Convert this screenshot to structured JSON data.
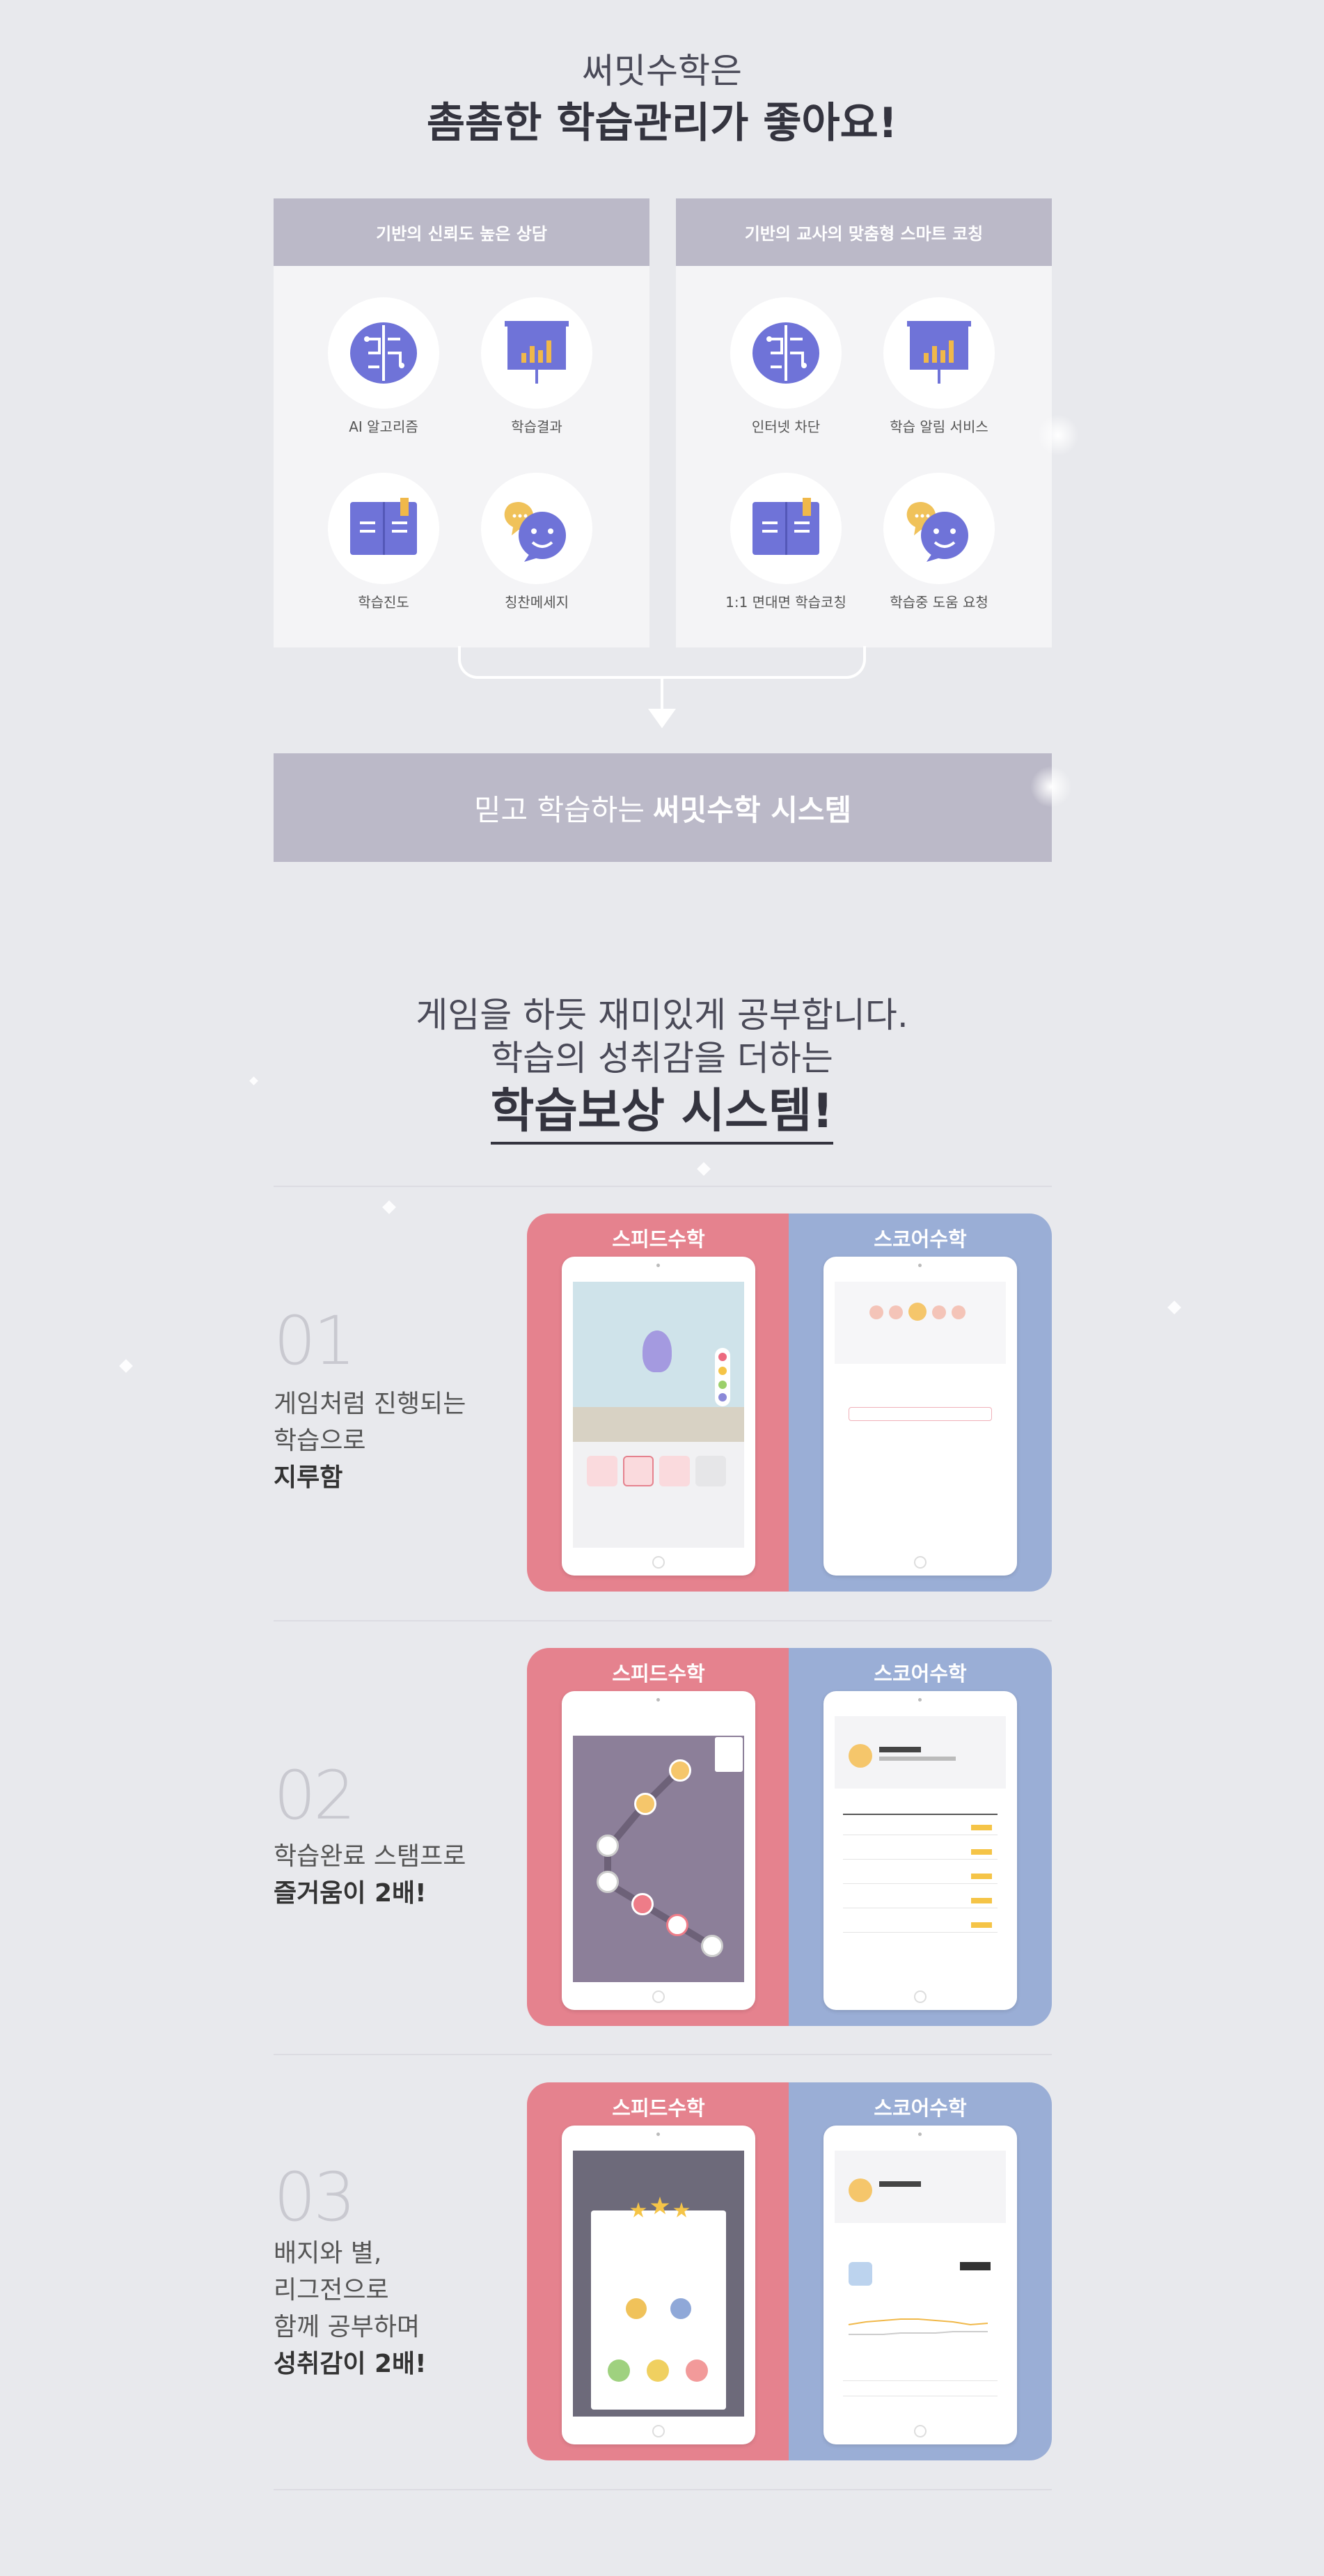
{
  "header": {
    "line1": "써밋수학은",
    "line2": "촘촘한 학습관리가 좋아요!"
  },
  "panels": [
    {
      "title": "기반의 신뢰도 높은 상담",
      "items": [
        {
          "label": "AI 알고리즘",
          "icon": "brain-icon"
        },
        {
          "label": "학습결과",
          "icon": "chart-board-icon"
        },
        {
          "label": "학습진도",
          "icon": "book-icon"
        },
        {
          "label": "칭찬메세지",
          "icon": "chat-smile-icon"
        }
      ]
    },
    {
      "title": "기반의 교사의 맞춤형 스마트 코칭",
      "items": [
        {
          "label": "인터넷 차단",
          "icon": "brain-icon"
        },
        {
          "label": "학습 알림 서비스",
          "icon": "chart-board-icon"
        },
        {
          "label": "1:1 면대면 학습코칭",
          "icon": "book-icon"
        },
        {
          "label": "학습중 도움 요청",
          "icon": "chat-smile-icon"
        }
      ]
    }
  ],
  "banner": {
    "prefix": "믿고 학습하는",
    "bold": "써밋수학 시스템"
  },
  "reward": {
    "line1": "게임을 하듯 재미있게 공부합니다.",
    "line2": "학습의 성취감을 더하는",
    "line3": "학습보상 시스템!"
  },
  "features": [
    {
      "num": "01",
      "lines": [
        "게임처럼 진행되는",
        "학습으로"
      ],
      "bold": "지루함",
      "left": "스피드수학",
      "right": "스코어수학"
    },
    {
      "num": "02",
      "lines": [
        "학습완료 스탬프로"
      ],
      "bold": "즐거움이 2배!",
      "left": "스피드수학",
      "right": "스코어수학"
    },
    {
      "num": "03",
      "lines": [
        "배지와 별,",
        "리그전으로",
        "함께 공부하며"
      ],
      "bold": "성취감이 2배!",
      "left": "스피드수학",
      "right": "스코어수학"
    }
  ],
  "colors": {
    "background": "#e8e9ed",
    "panel_header": "#bbb9c8",
    "icon": "#6f73d8",
    "accent_gold": "#f0b84a",
    "speed_card": "#e5828e",
    "score_card": "#9aaed6"
  }
}
